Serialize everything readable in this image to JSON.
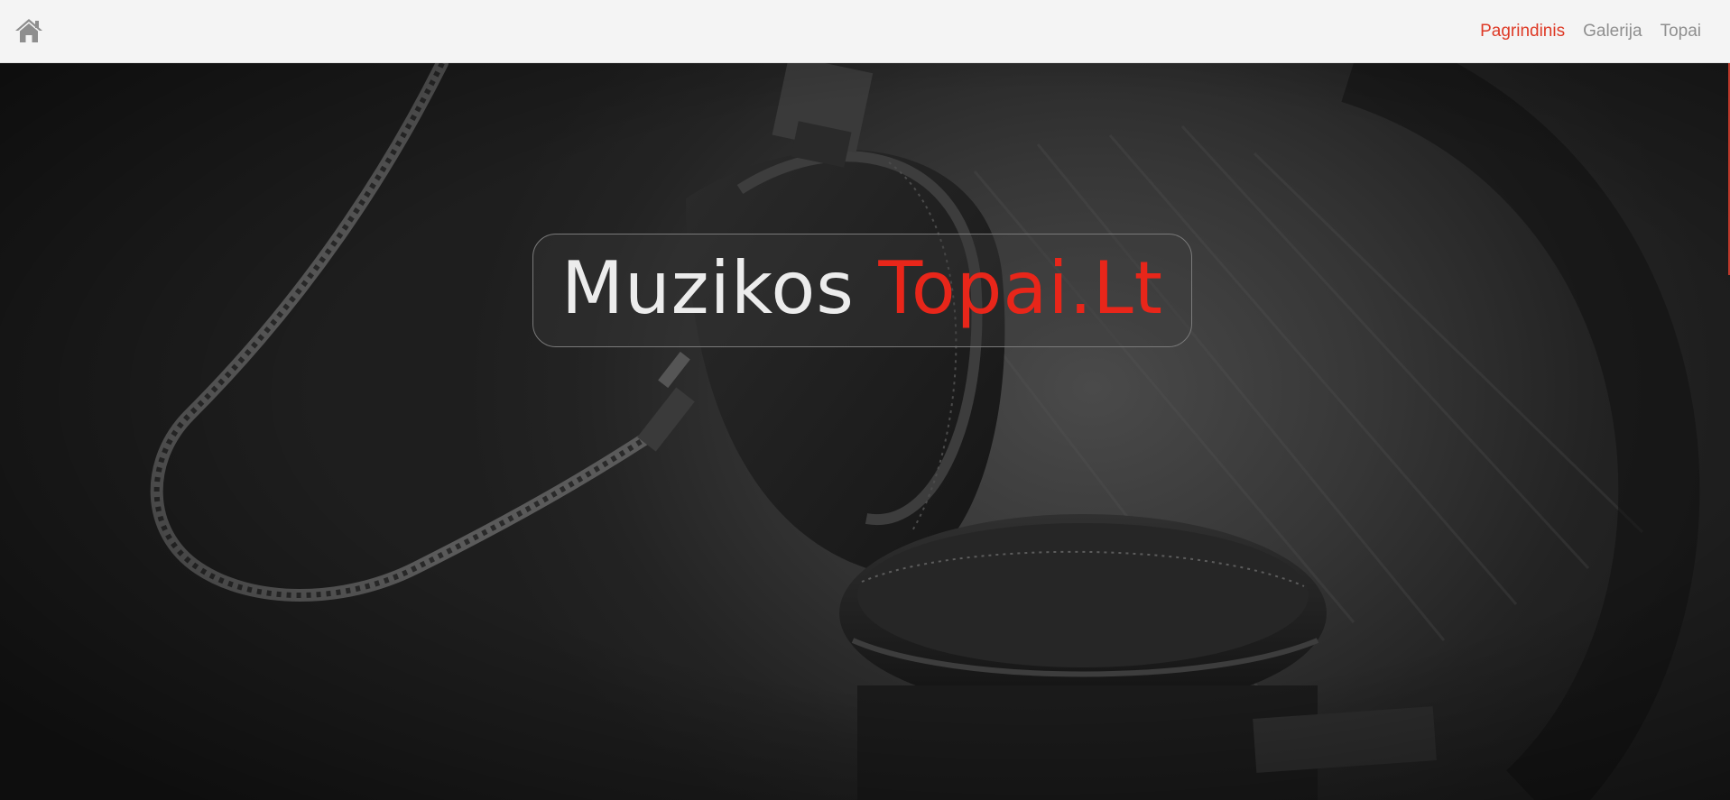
{
  "header": {
    "home_icon": "home-icon",
    "nav": [
      {
        "label": "Pagrindinis",
        "active": true
      },
      {
        "label": "Galerija",
        "active": false
      },
      {
        "label": "Topai",
        "active": false
      }
    ]
  },
  "hero": {
    "title_part1": "Muzikos",
    "title_part2": "Topai.Lt",
    "background": "headphones-photo"
  },
  "colors": {
    "accent": "#de3a26",
    "nav_inactive": "#8f8f8f",
    "navbar_bg": "#f4f4f4",
    "title_white": "#ececec",
    "title_red": "#e8261a"
  }
}
